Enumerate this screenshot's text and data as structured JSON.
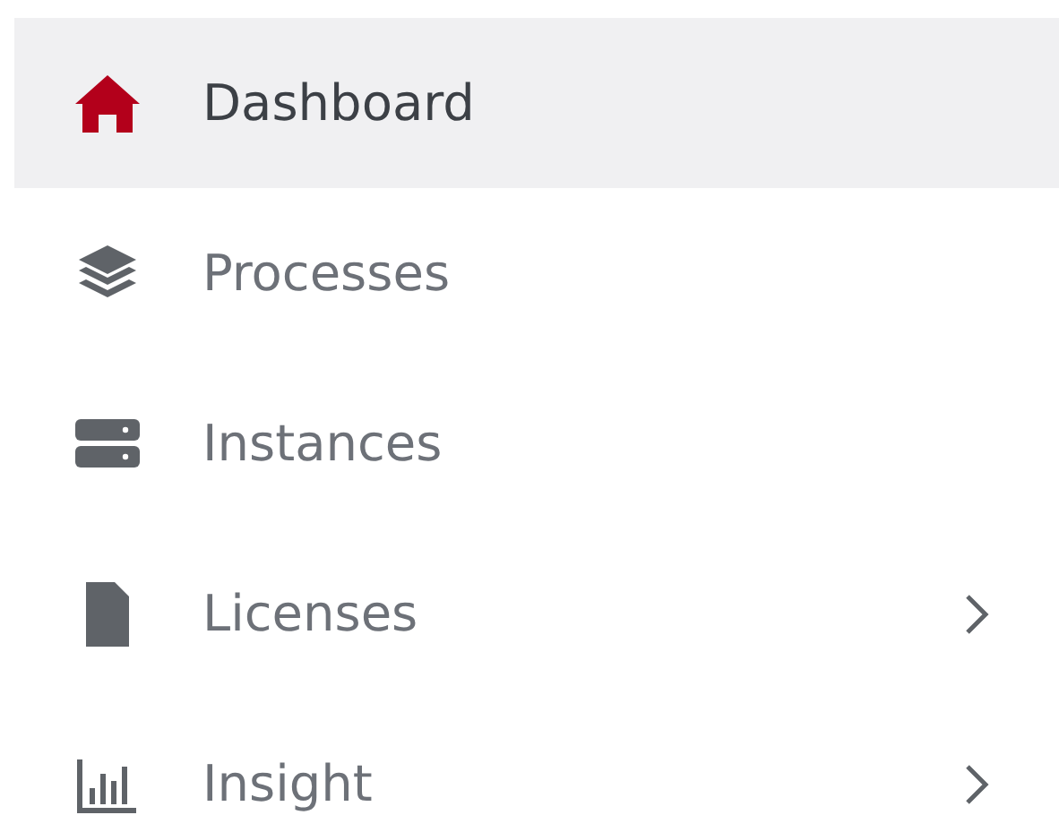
{
  "sidebar": {
    "items": [
      {
        "label": "Dashboard",
        "selected": true,
        "expandable": false
      },
      {
        "label": "Processes",
        "selected": false,
        "expandable": false
      },
      {
        "label": "Instances",
        "selected": false,
        "expandable": false
      },
      {
        "label": "Licenses",
        "selected": false,
        "expandable": true
      },
      {
        "label": "Insight",
        "selected": false,
        "expandable": true
      }
    ]
  }
}
